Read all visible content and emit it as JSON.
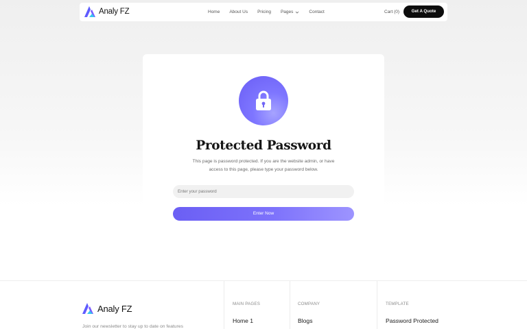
{
  "brand": {
    "name": "Analy FZ"
  },
  "nav": {
    "links": [
      {
        "label": "Home"
      },
      {
        "label": "About Us"
      },
      {
        "label": "Pricing"
      },
      {
        "label": "Pages"
      },
      {
        "label": "Contact"
      }
    ],
    "cart_label": "Cart (0)",
    "cta_label": "Get A Quote"
  },
  "card": {
    "icon": "lock-icon",
    "title": "Protected Password",
    "description_line1": "This page is password protected. If you are the website admin, or have",
    "description_line2": "access to this page, please type your password below.",
    "password_placeholder": "Enter your password",
    "password_value": "",
    "submit_label": "Enter Now"
  },
  "footer": {
    "brand": "Analy FZ",
    "newsletter_text": "Join our newsletter to stay up to date on features",
    "columns": [
      {
        "heading": "MAIN PAGES",
        "first_link": "Home 1"
      },
      {
        "heading": "COMPANY",
        "first_link": "Blogs"
      },
      {
        "heading": "TEMPLATE",
        "first_link": "Password Protected"
      }
    ]
  },
  "colors": {
    "accent": "#6b5ff4",
    "accent_light": "#9d94ff",
    "dark_button": "#0d0d0d",
    "logo_blue": "#3d5afe",
    "logo_purple": "#7a5cff",
    "logo_cyan": "#36c5f0"
  }
}
